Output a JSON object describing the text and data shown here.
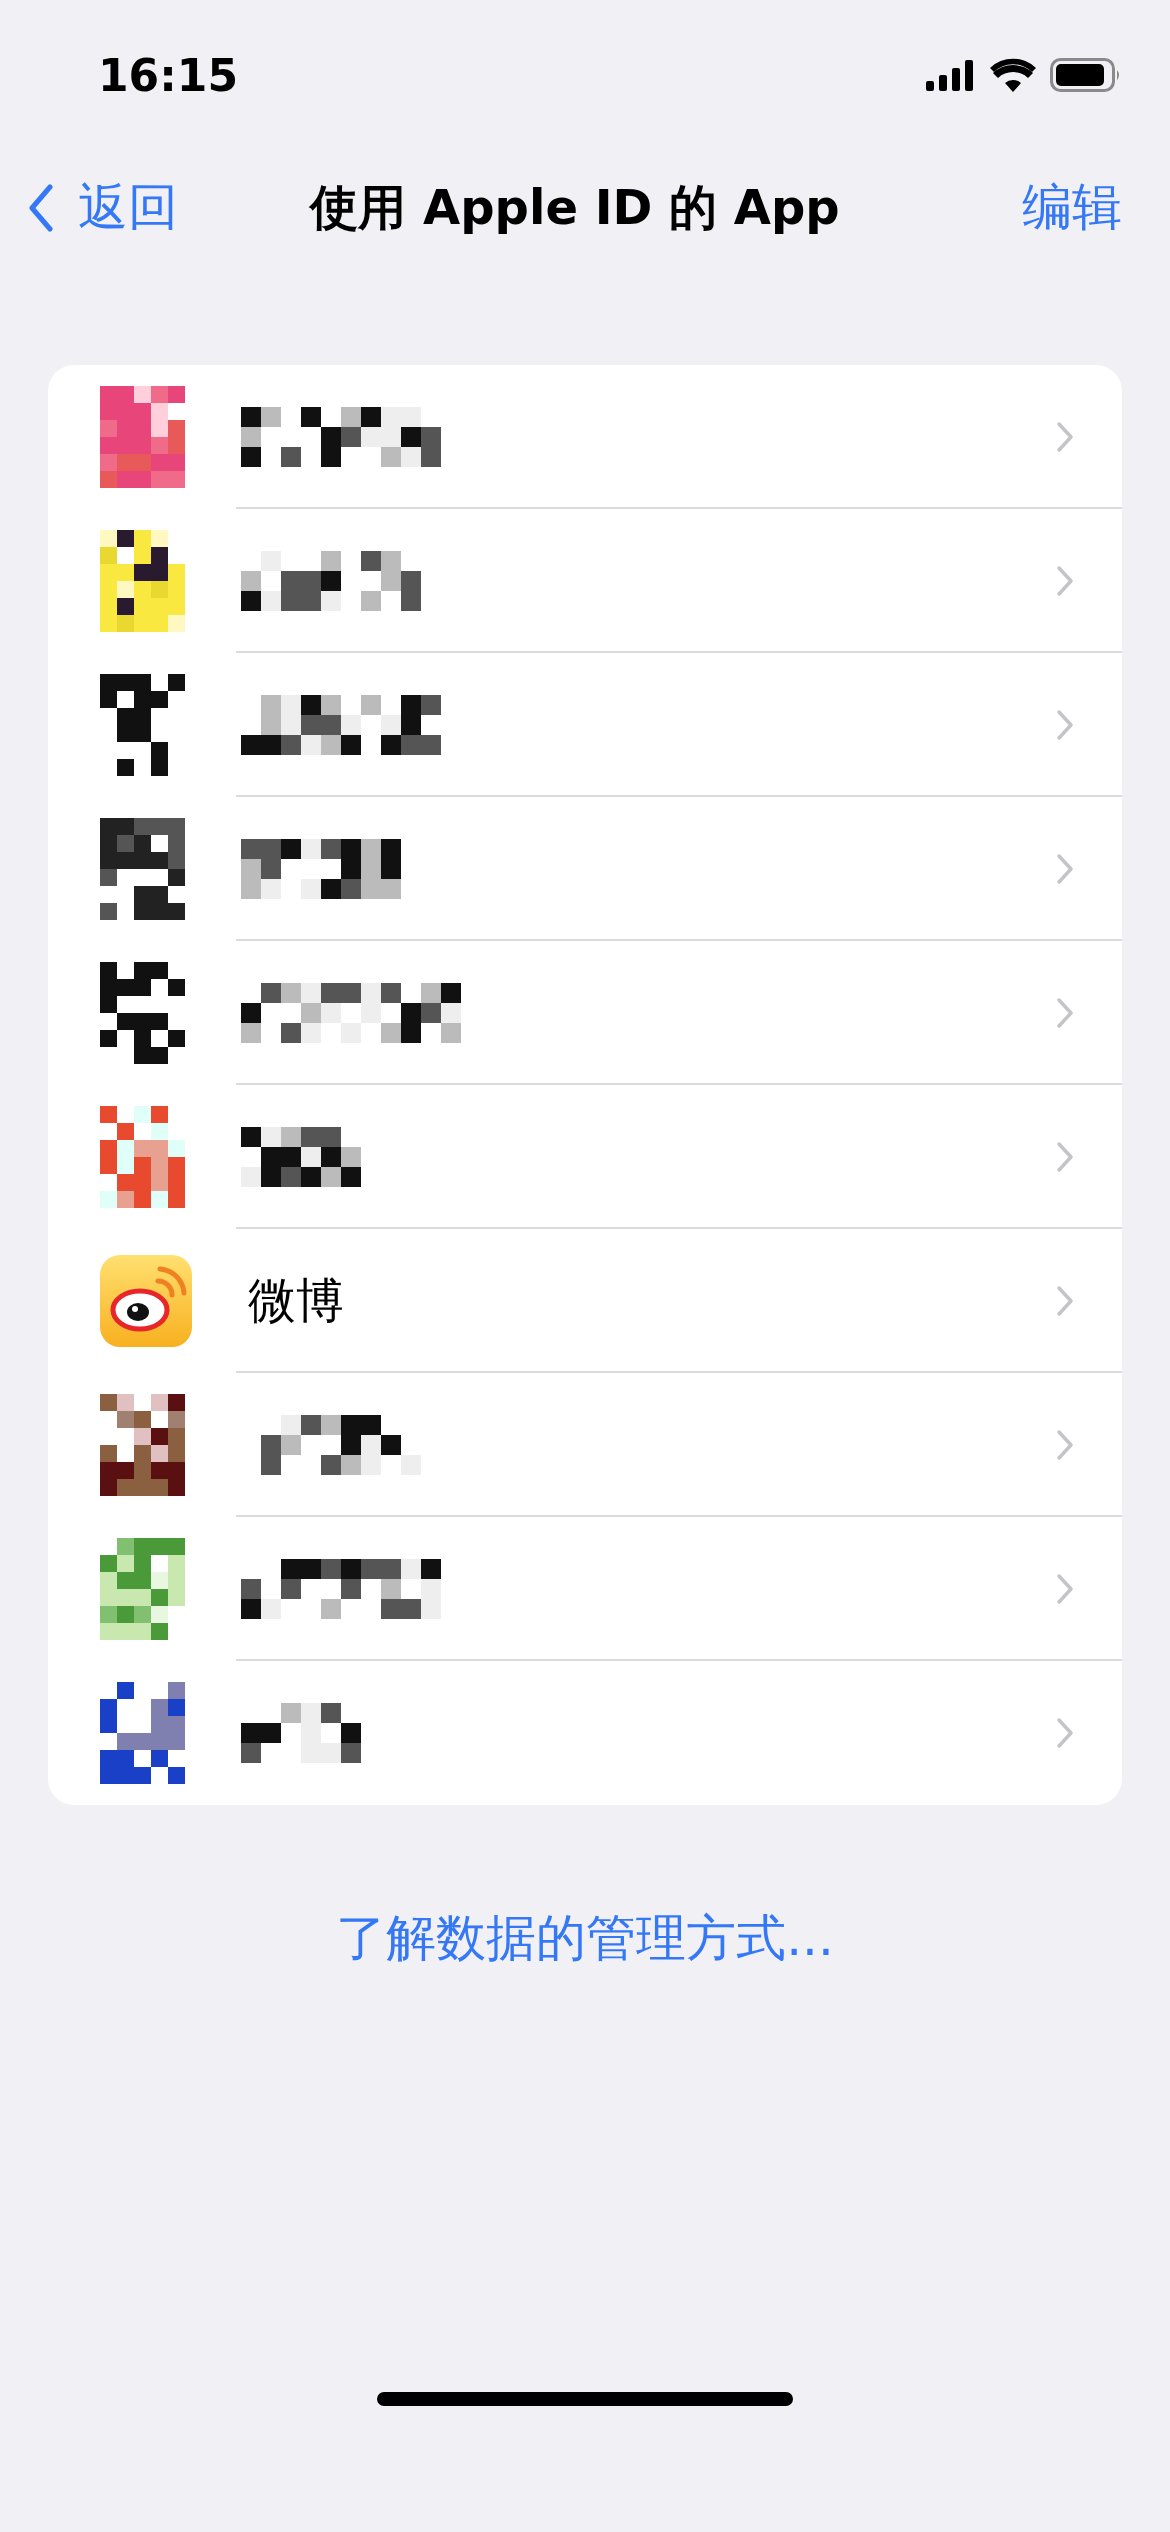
{
  "status_bar": {
    "time": "16:15"
  },
  "nav": {
    "back": "返回",
    "title": "使用 Apple ID 的 App",
    "edit": "编辑"
  },
  "apps": [
    {
      "kind": "redacted"
    },
    {
      "kind": "redacted"
    },
    {
      "kind": "redacted"
    },
    {
      "kind": "redacted"
    },
    {
      "kind": "redacted"
    },
    {
      "kind": "redacted"
    },
    {
      "kind": "app",
      "name": "微博"
    },
    {
      "kind": "redacted"
    },
    {
      "kind": "redacted"
    },
    {
      "kind": "redacted"
    }
  ],
  "footer_link": "了解数据的管理方式..."
}
